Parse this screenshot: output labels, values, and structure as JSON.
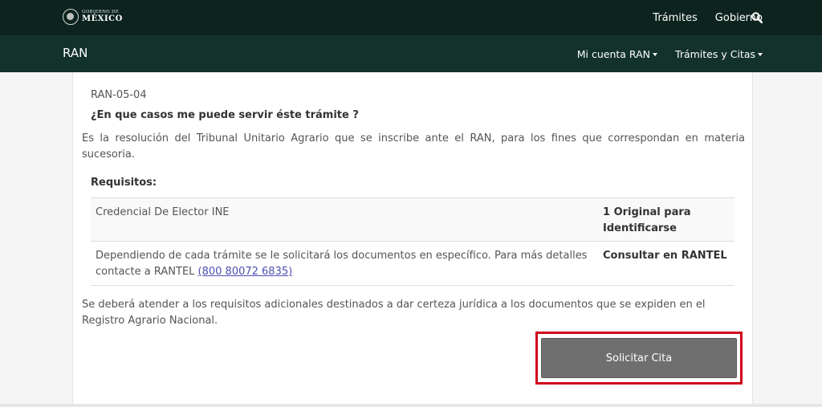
{
  "header": {
    "logo_line1": "GOBIERNO DE",
    "logo_line2": "MÉXICO",
    "nav": [
      "Trámites",
      "Gobierno"
    ],
    "search_icon": "search-icon"
  },
  "subheader": {
    "title": "RAN",
    "menus": [
      "Mi cuenta RAN",
      "Trámites y Citas"
    ]
  },
  "content": {
    "code": "RAN-05-04",
    "question": "¿En que casos me puede servir éste trámite ?",
    "description": "Es la resolución del Tribunal Unitario Agrario que se inscribe ante el RAN, para los fines que correspondan en materia sucesoria.",
    "requirements_title": "Requisitos:",
    "requirements": [
      {
        "document": "Credencial De Elector INE",
        "quantity": "1 Original para Identificarse"
      },
      {
        "document": "Dependiendo de cada trámite se le solicitará los documentos en específico. Para más detalles contacte a RANTEL",
        "link": "(800 80072 6835)",
        "quantity": "Consultar en RANTEL"
      }
    ],
    "note": "Se deberá atender a los requisitos adicionales destinados a dar certeza jurídica a los documentos que se expiden en el Registro Agrario Nacional.",
    "button_label": "Solicitar Cita"
  },
  "colors": {
    "top_bar": "#0c231e",
    "second_bar": "#13322b",
    "button": "#6f6f6f",
    "highlight": "#d0021b",
    "link": "#4b4fb0"
  }
}
